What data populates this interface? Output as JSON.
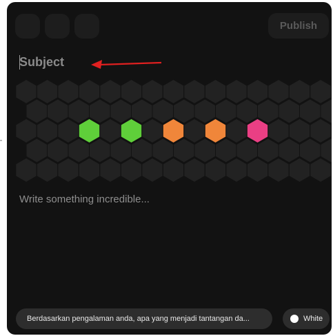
{
  "header": {
    "publish_label": "Publish"
  },
  "editor": {
    "subject_placeholder": "Subject",
    "body_placeholder": "Write something incredible..."
  },
  "hex_grid": {
    "base_color": "#222222",
    "active_color": "#1a1a1a",
    "highlights": [
      {
        "color": "#5fcf3a"
      },
      {
        "color": "#5fcf3a"
      },
      {
        "color": "#f0863a"
      },
      {
        "color": "#f0863a"
      },
      {
        "color": "#ea3f84"
      }
    ]
  },
  "annotation": {
    "arrow_color": "#e02020"
  },
  "footer": {
    "prompt_text": "Berdasarkan pengalaman anda, apa yang menjadi tantangan da...",
    "theme_label": "White"
  }
}
